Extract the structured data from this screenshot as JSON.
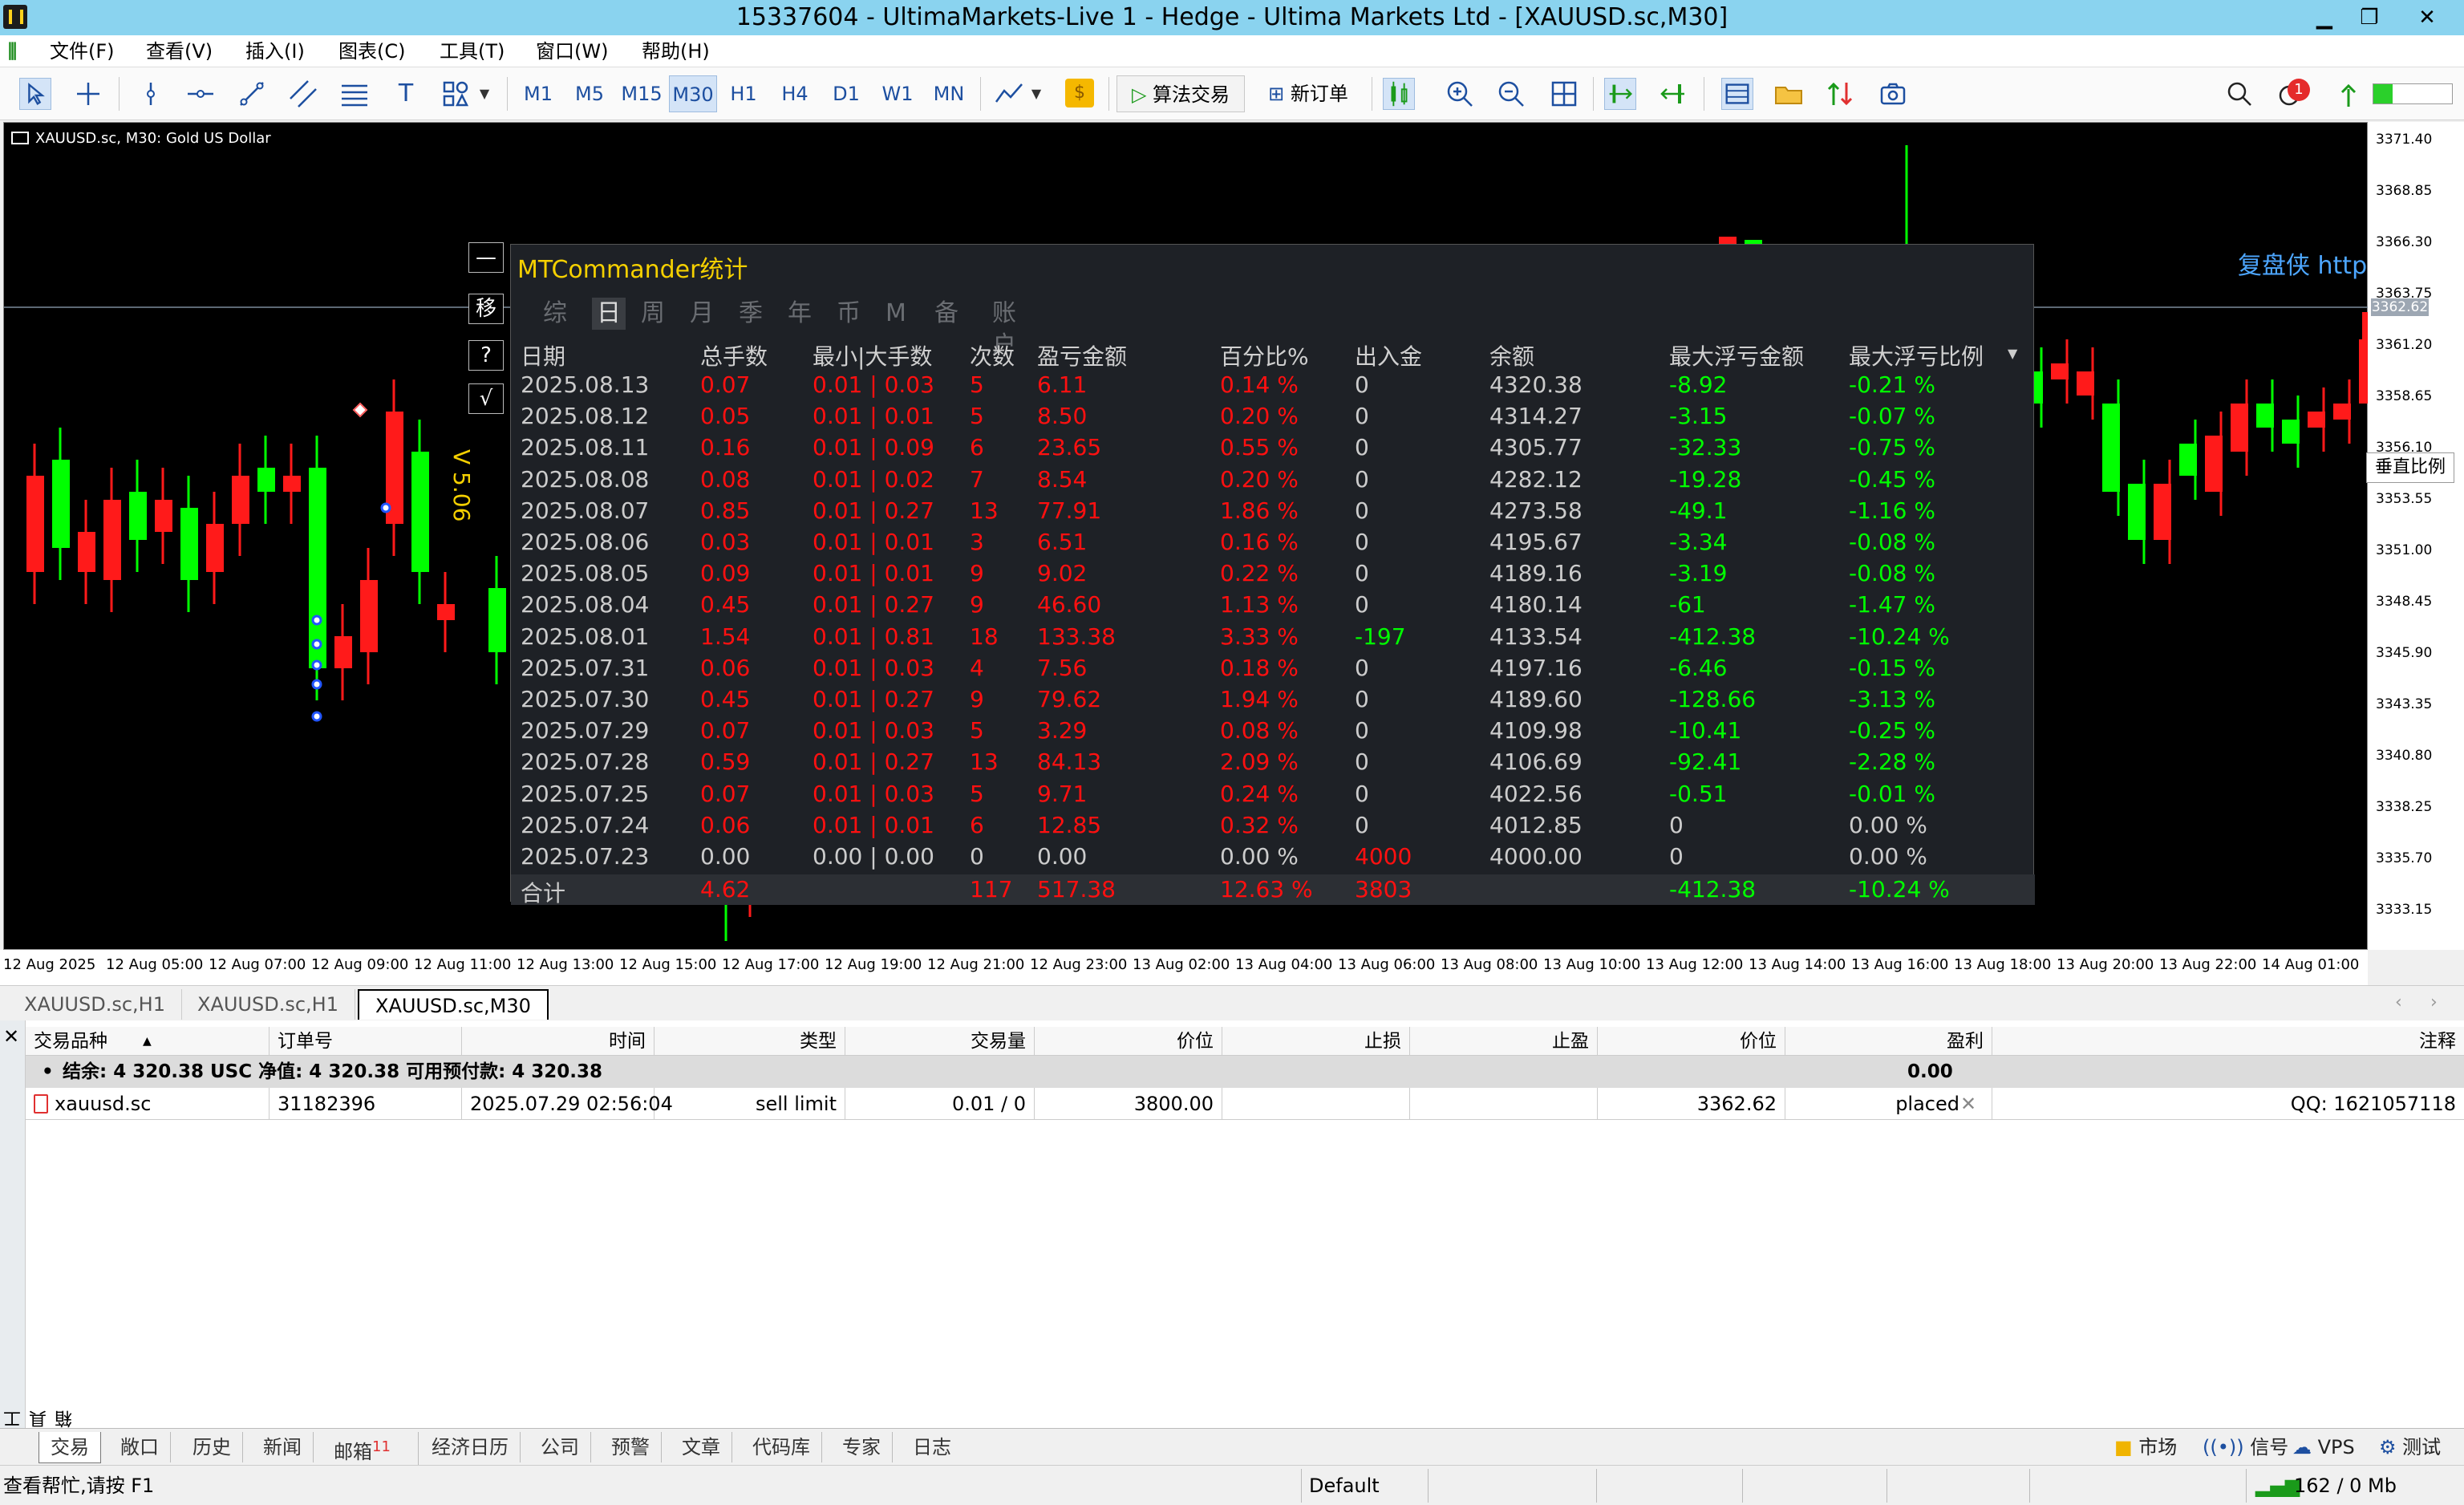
{
  "window": {
    "title": "15337604 - UltimaMarkets-Live 1 - Hedge - Ultima Markets Ltd - [XAUUSD.sc,M30]"
  },
  "menu": [
    "文件(F)",
    "查看(V)",
    "插入(I)",
    "图表(C)",
    "工具(T)",
    "窗口(W)",
    "帮助(H)"
  ],
  "toolbar": {
    "timeframes": [
      "M1",
      "M5",
      "M15",
      "M30",
      "H1",
      "H4",
      "D1",
      "W1",
      "MN"
    ],
    "selected_timeframe": "M30",
    "algo_label": "算法交易",
    "new_order_label": "新订单",
    "notification_count": "1"
  },
  "chart": {
    "symbol_label": "XAUUSD.sc, M30:  Gold US Dollar",
    "price_ticks": [
      "3371.40",
      "3368.85",
      "3366.30",
      "3363.75",
      "3361.20",
      "3358.65",
      "3356.10",
      "3353.55",
      "3351.00",
      "3348.45",
      "3345.90",
      "3343.35",
      "3340.80",
      "3338.25",
      "3335.70",
      "3333.15"
    ],
    "current_price": "3362.62",
    "time_ticks": [
      "12 Aug 2025",
      "12 Aug 05:00",
      "12 Aug 07:00",
      "12 Aug 09:00",
      "12 Aug 11:00",
      "12 Aug 13:00",
      "12 Aug 15:00",
      "12 Aug 17:00",
      "12 Aug 19:00",
      "12 Aug 21:00",
      "12 Aug 23:00",
      "13 Aug 02:00",
      "13 Aug 04:00",
      "13 Aug 06:00",
      "13 Aug 08:00",
      "13 Aug 10:00",
      "13 Aug 12:00",
      "13 Aug 14:00",
      "13 Aug 16:00",
      "13 Aug 18:00",
      "13 Aug 20:00",
      "13 Aug 22:00",
      "14 Aug 01:00"
    ],
    "fupan_label": "复盘侠 http:",
    "vert_scale_label": "垂直比例",
    "side_buttons": [
      "—",
      "移",
      "?",
      "√"
    ],
    "version_label": "V 5.06",
    "colors": {
      "bull": "#00ff00",
      "bear": "#ff1a1a"
    }
  },
  "panel": {
    "title": "MTCommander统计",
    "tabs": [
      "综",
      "日",
      "周",
      "月",
      "季",
      "年",
      "币",
      "M",
      "备",
      "账户"
    ],
    "active_tab": "日",
    "headers": [
      "日期",
      "总手数",
      "最小|大手数",
      "次数",
      "盈亏金额",
      "百分比%",
      "出入金",
      "余额",
      "最大浮亏金额",
      "最大浮亏比例"
    ],
    "rows": [
      [
        "2025.08.13",
        "0.07",
        "0.01 | 0.03",
        "5",
        "6.11",
        "0.14 %",
        "0",
        "4320.38",
        "-8.92",
        "-0.21 %"
      ],
      [
        "2025.08.12",
        "0.05",
        "0.01 | 0.01",
        "5",
        "8.50",
        "0.20 %",
        "0",
        "4314.27",
        "-3.15",
        "-0.07 %"
      ],
      [
        "2025.08.11",
        "0.16",
        "0.01 | 0.09",
        "6",
        "23.65",
        "0.55 %",
        "0",
        "4305.77",
        "-32.33",
        "-0.75 %"
      ],
      [
        "2025.08.08",
        "0.08",
        "0.01 | 0.02",
        "7",
        "8.54",
        "0.20 %",
        "0",
        "4282.12",
        "-19.28",
        "-0.45 %"
      ],
      [
        "2025.08.07",
        "0.85",
        "0.01 | 0.27",
        "13",
        "77.91",
        "1.86 %",
        "0",
        "4273.58",
        "-49.1",
        "-1.16 %"
      ],
      [
        "2025.08.06",
        "0.03",
        "0.01 | 0.01",
        "3",
        "6.51",
        "0.16 %",
        "0",
        "4195.67",
        "-3.34",
        "-0.08 %"
      ],
      [
        "2025.08.05",
        "0.09",
        "0.01 | 0.01",
        "9",
        "9.02",
        "0.22 %",
        "0",
        "4189.16",
        "-3.19",
        "-0.08 %"
      ],
      [
        "2025.08.04",
        "0.45",
        "0.01 | 0.27",
        "9",
        "46.60",
        "1.13 %",
        "0",
        "4180.14",
        "-61",
        "-1.47 %"
      ],
      [
        "2025.08.01",
        "1.54",
        "0.01 | 0.81",
        "18",
        "133.38",
        "3.33 %",
        "-197",
        "4133.54",
        "-412.38",
        "-10.24 %"
      ],
      [
        "2025.07.31",
        "0.06",
        "0.01 | 0.03",
        "4",
        "7.56",
        "0.18 %",
        "0",
        "4197.16",
        "-6.46",
        "-0.15 %"
      ],
      [
        "2025.07.30",
        "0.45",
        "0.01 | 0.27",
        "9",
        "79.62",
        "1.94 %",
        "0",
        "4189.60",
        "-128.66",
        "-3.13 %"
      ],
      [
        "2025.07.29",
        "0.07",
        "0.01 | 0.03",
        "5",
        "3.29",
        "0.08 %",
        "0",
        "4109.98",
        "-10.41",
        "-0.25 %"
      ],
      [
        "2025.07.28",
        "0.59",
        "0.01 | 0.27",
        "13",
        "84.13",
        "2.09 %",
        "0",
        "4106.69",
        "-92.41",
        "-2.28 %"
      ],
      [
        "2025.07.25",
        "0.07",
        "0.01 | 0.03",
        "5",
        "9.71",
        "0.24 %",
        "0",
        "4022.56",
        "-0.51",
        "-0.01 %"
      ],
      [
        "2025.07.24",
        "0.06",
        "0.01 | 0.01",
        "6",
        "12.85",
        "0.32 %",
        "0",
        "4012.85",
        "0",
        "0.00 %"
      ],
      [
        "2025.07.23",
        "0.00",
        "0.00 | 0.00",
        "0",
        "0.00",
        "0.00 %",
        "4000",
        "4000.00",
        "0",
        "0.00 %"
      ]
    ],
    "total": [
      "合计",
      "4.62",
      "",
      "117",
      "517.38",
      "12.63 %",
      "3803",
      "",
      "-412.38",
      "-10.24 %"
    ]
  },
  "chart_tabs": [
    "XAUUSD.sc,H1",
    "XAUUSD.sc,H1",
    "XAUUSD.sc,M30"
  ],
  "terminal": {
    "side_label": "工具箱",
    "headers": [
      "交易品种",
      "订单号",
      "时间",
      "类型",
      "交易量",
      "价位",
      "止损",
      "止盈",
      "价位",
      "盈利",
      "注释"
    ],
    "balance_line": "结余: 4 320.38 USC  净值: 4 320.38  可用预付款: 4 320.38",
    "balance_profit": "0.00",
    "order": {
      "symbol": "xauusd.sc",
      "ticket": "31182396",
      "time": "2025.07.29 02:56:04",
      "type": "sell limit",
      "volume": "0.01 / 0",
      "price": "3800.00",
      "sl": "",
      "tp": "",
      "cur_price": "3362.62",
      "profit": "placed",
      "comment": "QQ: 1621057118"
    }
  },
  "bottom_tabs": [
    "交易",
    "敞口",
    "历史",
    "新闻",
    "邮箱",
    "经济日历",
    "公司",
    "预警",
    "文章",
    "代码库",
    "专家",
    "日志"
  ],
  "mail_count": "11",
  "bottom_right": [
    "市场",
    "信号",
    "VPS",
    "测试"
  ],
  "status": {
    "help": "查看帮忙,请按 F1",
    "profile": "Default",
    "traffic": "162 / 0 Mb"
  }
}
